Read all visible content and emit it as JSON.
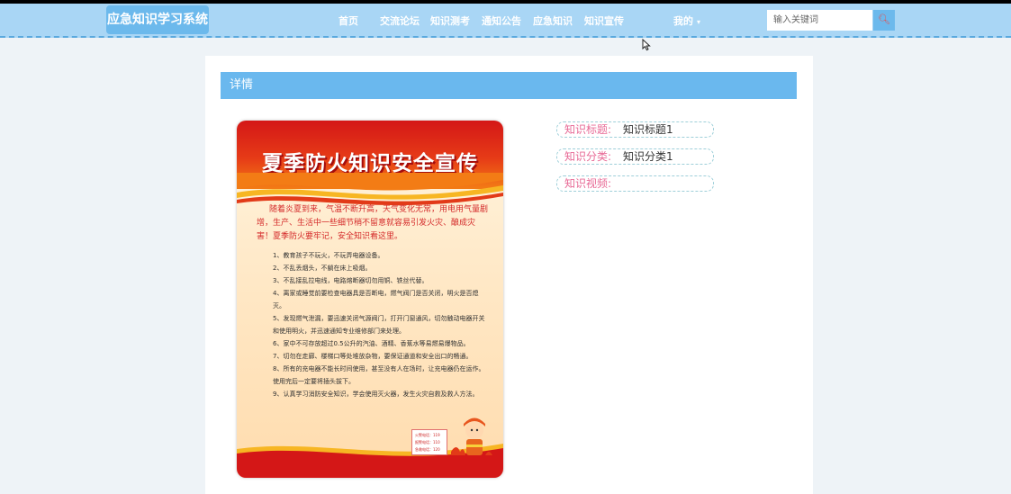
{
  "app": {
    "title": "应急知识学习系统"
  },
  "nav": {
    "items": [
      {
        "label": "首页"
      },
      {
        "label": "交流论坛"
      },
      {
        "label": "知识测考"
      },
      {
        "label": "通知公告"
      },
      {
        "label": "应急知识"
      },
      {
        "label": "知识宣传"
      }
    ],
    "user_menu": "我的",
    "search": {
      "placeholder": "输入关键词",
      "value": ""
    }
  },
  "detail": {
    "header": "详情",
    "fields": [
      {
        "label": "知识标题:",
        "value": "知识标题1"
      },
      {
        "label": "知识分类:",
        "value": "知识分类1"
      },
      {
        "label": "知识视频:",
        "value": ""
      }
    ],
    "poster": {
      "title": "夏季防火知识安全宣传",
      "intro": "随着炎夏到来，气温不断升高，天气变化无常，用电用气量剧增，生产、生活中一些细节稍不留意就容易引发火灾、酿成灾害！夏季防火要牢记，安全知识看这里。",
      "tips": [
        "1、教育孩子不玩火，不玩弄电器设备。",
        "2、不乱丢烟头，不躺在床上吸烟。",
        "3、不乱接乱拉电线，电路熔断器切勿用铜、铁丝代替。",
        "4、离家或睡觉前要检查电器具是否断电，燃气阀门是否关闭，明火是否熄灭。",
        "5、发现燃气泄漏，要迅速关闭气源阀门，打开门窗通风，切勿触动电器开关和使用明火，并迅速通知专业维修部门来处理。",
        "6、家中不可存放超过0.5公升的汽油、酒精、香蕉水等易燃易爆物品。",
        "7、切勿在走廊、楼梯口等处堆放杂物，要保证通道和安全出口的畅通。",
        "8、所有的充电器不能长时间使用，甚至没有人在场时，让充电器仍在运作。使用完后一定要将插头拔下。",
        "9、认真学习消防安全知识，学会使用灭火器，发生火灾自救及救人方法。"
      ],
      "phones": [
        "火警电话：119",
        "报警电话：110",
        "急救电话：120"
      ]
    }
  },
  "colors": {
    "navbar": "#a9d6f5",
    "accent": "#6ab8ee",
    "label": "#e86a96",
    "poster_red": "#d41717"
  }
}
